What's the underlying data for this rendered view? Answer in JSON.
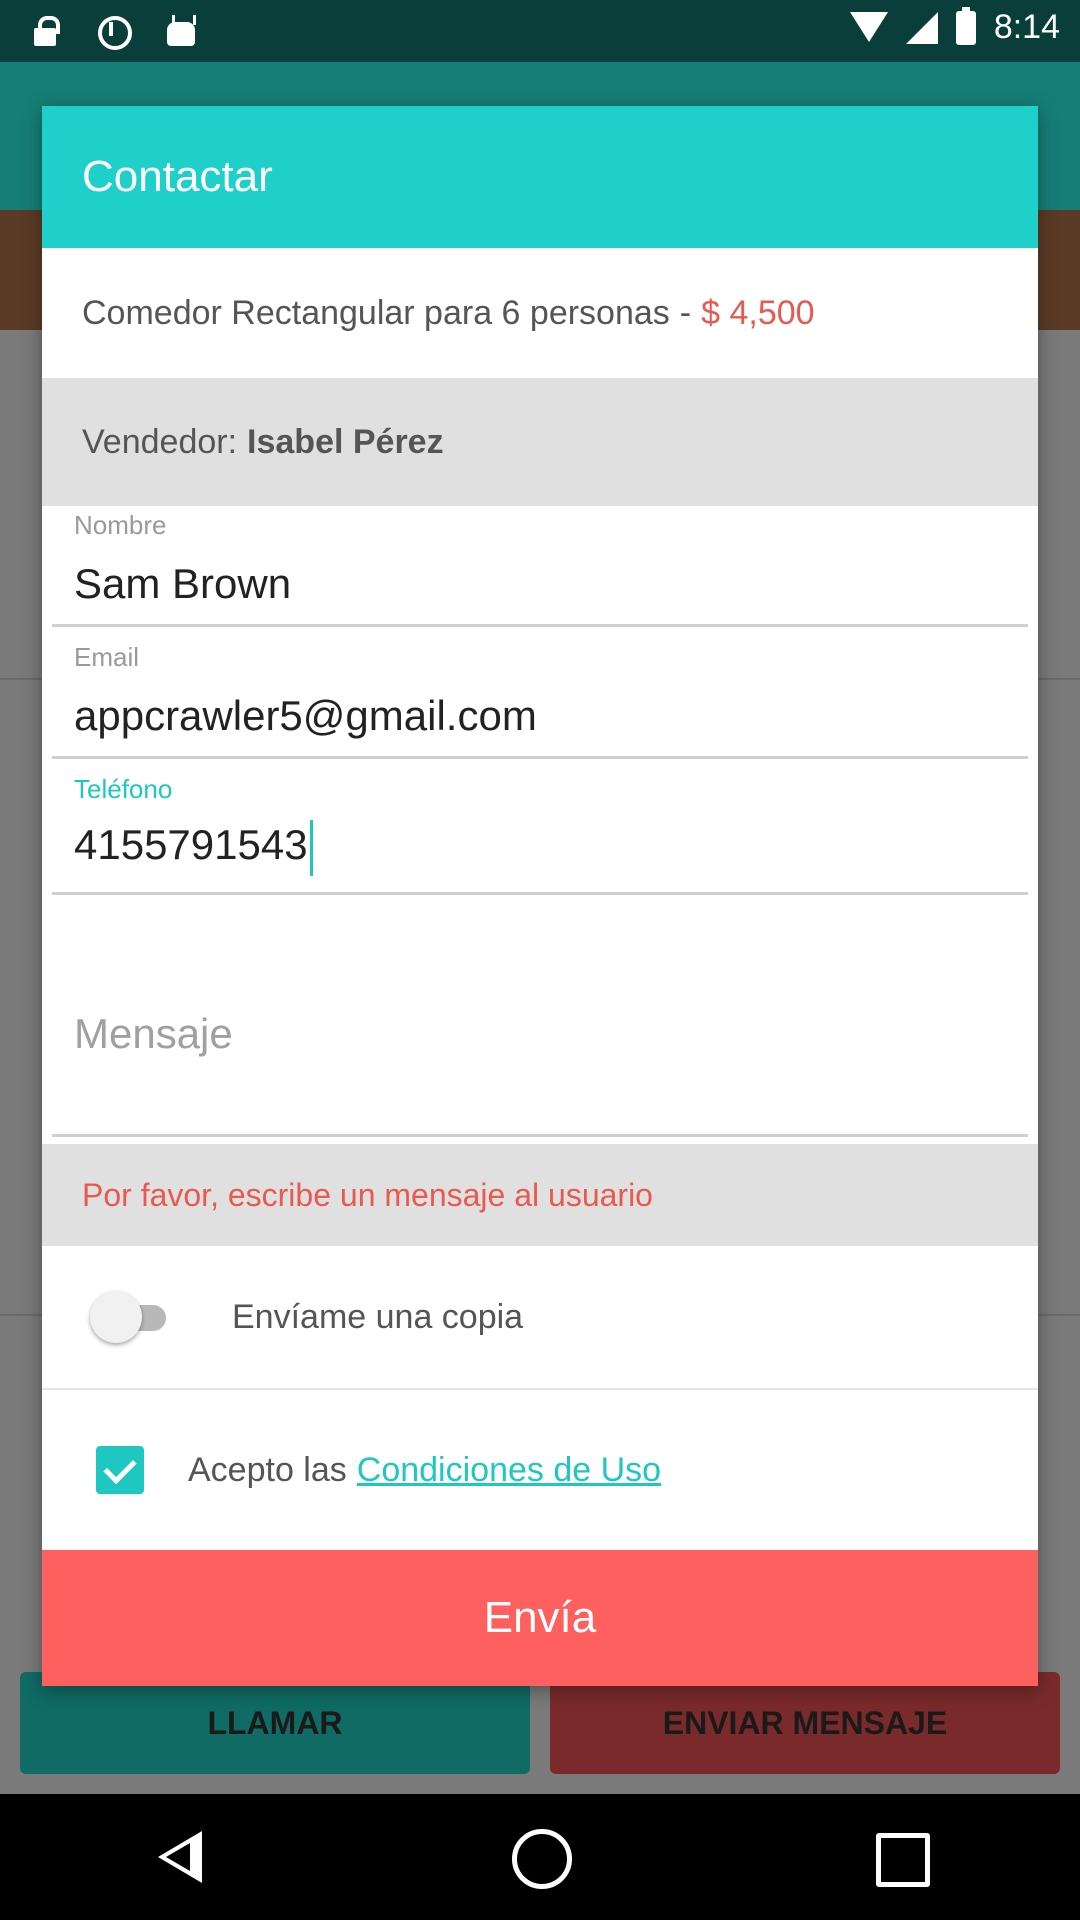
{
  "status_bar": {
    "time": "8:14",
    "left_icons": [
      "lock-icon",
      "circle-icon",
      "android-icon"
    ],
    "right_icons": [
      "wifi-icon",
      "signal-icon",
      "battery-icon"
    ]
  },
  "background": {
    "call_button": "LLAMAR",
    "message_button": "ENVIAR MENSAJE"
  },
  "dialog": {
    "title": "Contactar",
    "product": {
      "name": "Comedor Rectangular para 6 personas",
      "separator": "-",
      "price": "$ 4,500"
    },
    "vendor": {
      "label": "Vendedor:",
      "name": "Isabel Pérez"
    },
    "fields": {
      "name": {
        "label": "Nombre",
        "value": "Sam Brown"
      },
      "email": {
        "label": "Email",
        "value": "appcrawler5@gmail.com"
      },
      "phone": {
        "label": "Teléfono",
        "value": "4155791543"
      },
      "message": {
        "placeholder": "Mensaje",
        "value": ""
      }
    },
    "notice": "Por favor, escribe un mensaje al usuario",
    "copy_toggle": {
      "label": "Envíame una copia",
      "checked": false
    },
    "terms": {
      "label": "Acepto las",
      "link": "Condiciones de Uso",
      "checked": true
    },
    "send_button": "Envía"
  },
  "colors": {
    "accent": "#1ed0c9",
    "error": "#e85a4f",
    "send": "#fe5f5f"
  }
}
